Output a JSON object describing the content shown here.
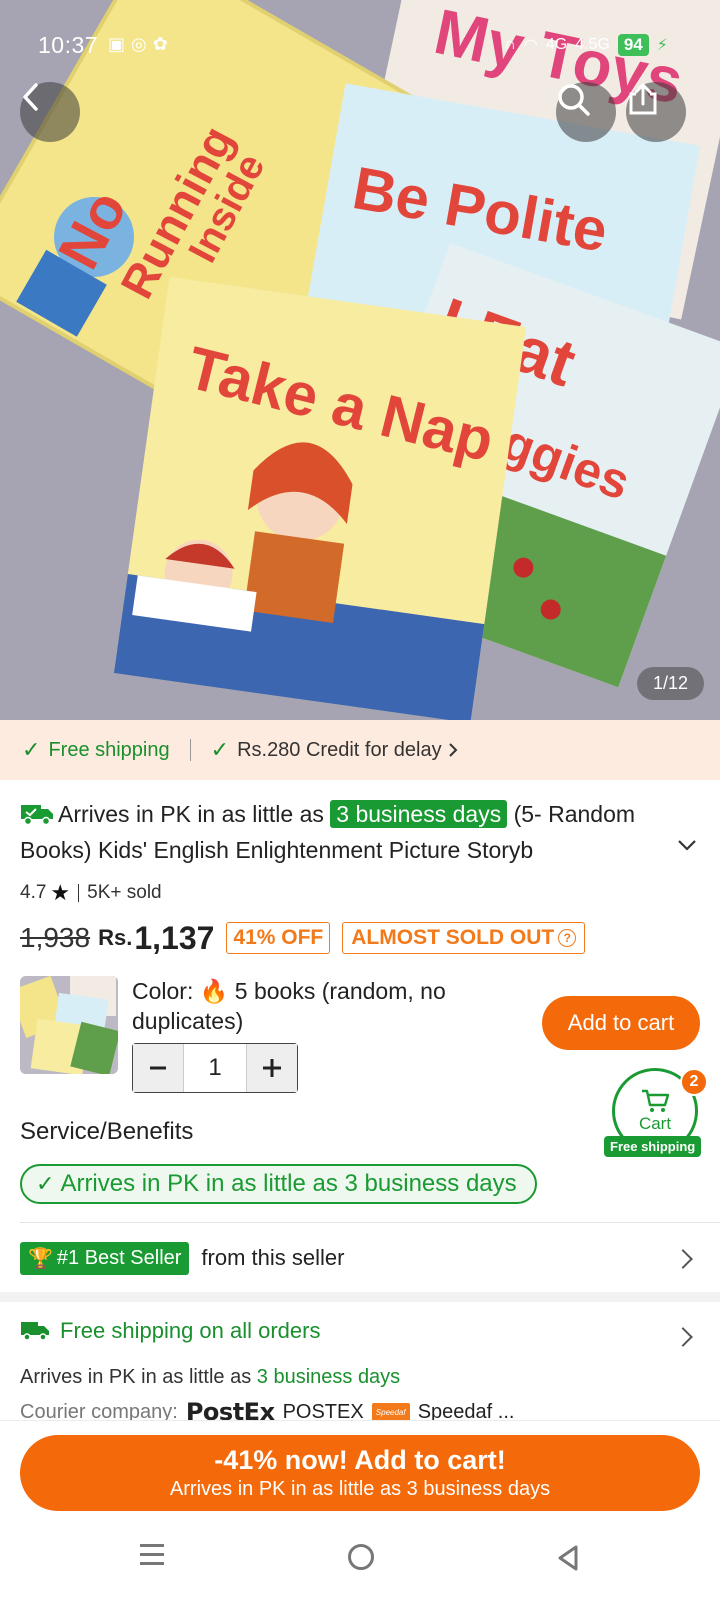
{
  "status_bar": {
    "time": "10:37",
    "network_4g": "4G",
    "network_45g": "4.5G",
    "battery": "94"
  },
  "hero": {
    "pager": "1/12",
    "book_titles": [
      "No Running Inside",
      "My Toys",
      "Be Polite",
      "I Eat Veggies",
      "Take a Nap"
    ]
  },
  "shipping_strip": {
    "free_shipping": "Free shipping",
    "credit": "Rs.280 Credit for delay"
  },
  "product": {
    "arrives_prefix": "Arrives in PK in as little as",
    "arrives_badge": "3 business days",
    "title_rest": "(5- Random",
    "title_line2": "Books) Kids' English Enlightenment Picture Storyb",
    "rating": "4.7",
    "sold": "5K+ sold",
    "old_price": "1,938",
    "currency": "Rs.",
    "price": "1,137",
    "discount": "41% OFF",
    "almost_sold_out": "ALMOST SOLD OUT"
  },
  "variant": {
    "color_label": "Color:",
    "color_value": "5 books (random, no duplicates)",
    "quantity": "1",
    "add_to_cart": "Add to cart"
  },
  "cart": {
    "label": "Cart",
    "count": "2",
    "free_shipping": "Free shipping"
  },
  "service": {
    "title": "Service/Benefits",
    "pill": "Arrives in PK in as little as 3 business days"
  },
  "best_seller": {
    "badge": "#1 Best Seller",
    "text": "from this seller"
  },
  "delivery": {
    "free_all": "Free shipping on all orders",
    "arrives_prefix": "Arrives in PK in as little as",
    "arrives_days": "3 business days",
    "courier_label": "Courier company:",
    "postex_logo": "PostEx",
    "postex_name": "POSTEX",
    "speedaf_logo": "Speedaf",
    "speedaf_name": "Speedaf ..."
  },
  "cta": {
    "line1": "-41% now! Add to cart!",
    "line2": "Arrives in PK in as little as 3 business days"
  },
  "colors": {
    "accent_orange": "#f46a0a",
    "green": "#1a9a33",
    "strip_bg": "#fdebe0"
  }
}
